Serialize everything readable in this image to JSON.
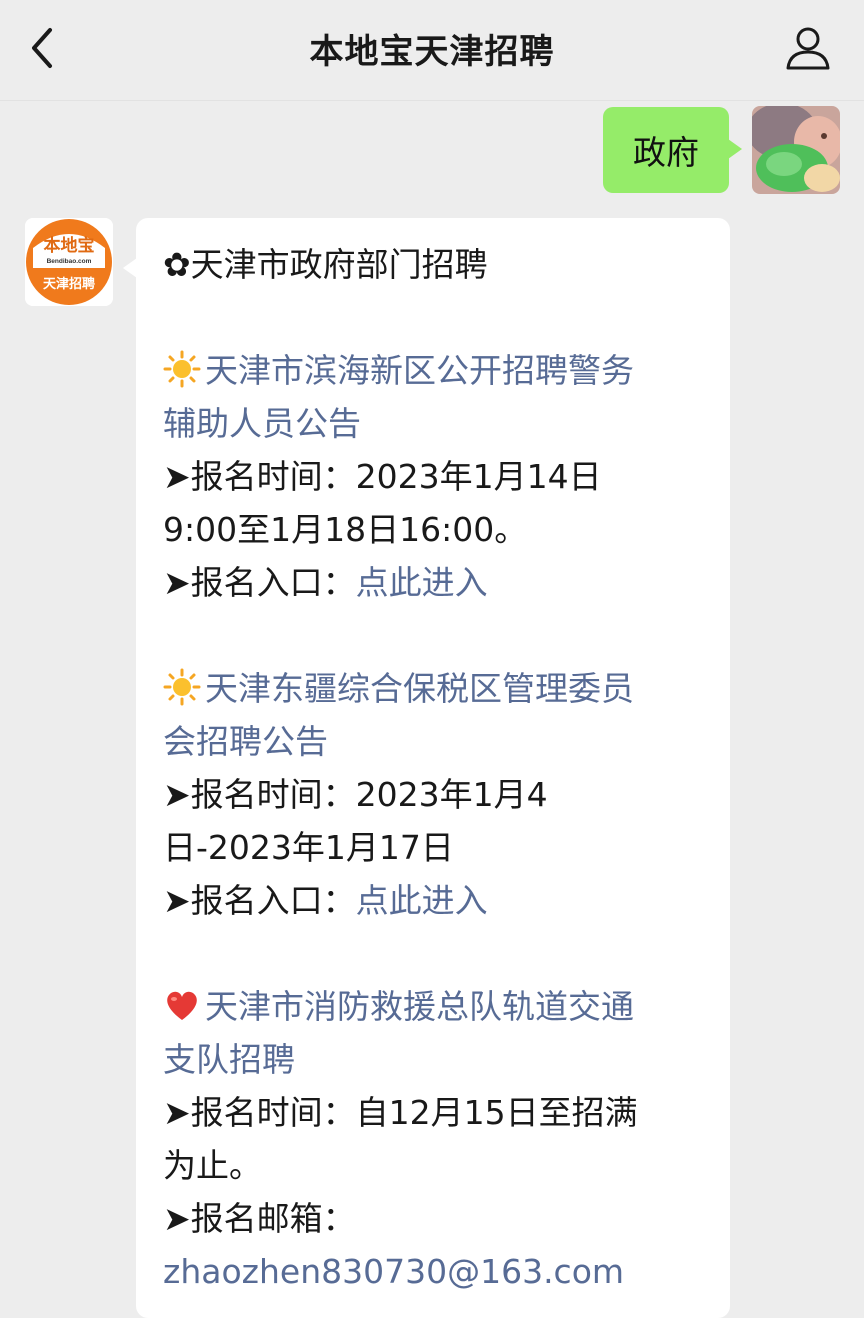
{
  "header": {
    "title": "本地宝天津招聘",
    "back_icon": "chevron-left-icon",
    "profile_icon": "person-icon"
  },
  "outgoing": {
    "text": "政府"
  },
  "account_logo": {
    "brand": "本地宝",
    "domain": "Bendibao.com",
    "sub": "天津招聘"
  },
  "message": {
    "heading_bullet": "✿",
    "heading": "天津市政府部门招聘",
    "items": [
      {
        "icon": "sun-emoji",
        "title_line1": "天津市滨海新区公开招聘警务",
        "title_line2": "辅助人员公告",
        "time_label": "➤报名时间：",
        "time_line1": "2023年1月14日",
        "time_line2": "9:00至1月18日16:00。",
        "entry_label": "➤报名入口：",
        "entry_link": "点此进入"
      },
      {
        "icon": "sun-emoji",
        "title_line1": "天津东疆综合保税区管理委员",
        "title_line2": "会招聘公告",
        "time_label": "➤报名时间：",
        "time_line1": "2023年1月4",
        "time_line2": "日-2023年1月17日",
        "entry_label": "➤报名入口：",
        "entry_link": "点此进入"
      },
      {
        "icon": "heart-emoji",
        "title_line1": "天津市消防救援总队轨道交通",
        "title_line2": "支队招聘",
        "time_label": "➤报名时间：",
        "time_line1": "自12月15日至招满",
        "time_line2": "为止。",
        "email_label": "➤报名邮箱：",
        "email": "zhaozhen830730@163.com"
      }
    ]
  },
  "colors": {
    "background": "#ededed",
    "outgoing_bubble": "#95ec69",
    "link": "#576b95",
    "brand_orange": "#f07a1c"
  }
}
